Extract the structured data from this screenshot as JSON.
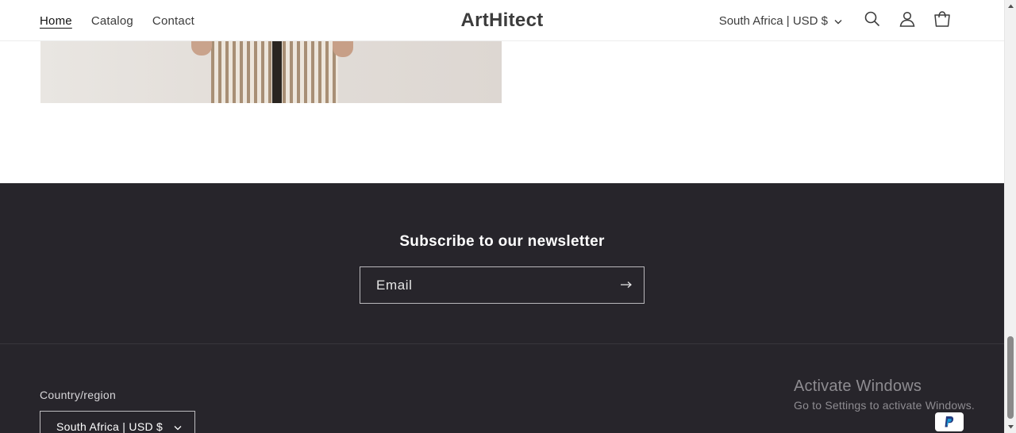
{
  "header": {
    "nav": [
      {
        "label": "Home",
        "active": true
      },
      {
        "label": "Catalog",
        "active": false
      },
      {
        "label": "Contact",
        "active": false
      }
    ],
    "brand": "ArtHitect",
    "country_selector": "South Africa | USD $",
    "icons": [
      "search-icon",
      "account-icon",
      "cart-icon",
      "chevron-down-icon"
    ]
  },
  "footer": {
    "newsletter_title": "Subscribe to our newsletter",
    "email_placeholder": "Email",
    "region_label": "Country/region",
    "region_value": "South Africa | USD $",
    "payment_icons": [
      "paypal-icon"
    ]
  },
  "os_overlay": {
    "title": "Activate Windows",
    "subtitle": "Go to Settings to activate Windows."
  },
  "colors": {
    "footer_bg": "#27252b",
    "text_dark": "#121212",
    "brand": "#3c3c3c"
  }
}
